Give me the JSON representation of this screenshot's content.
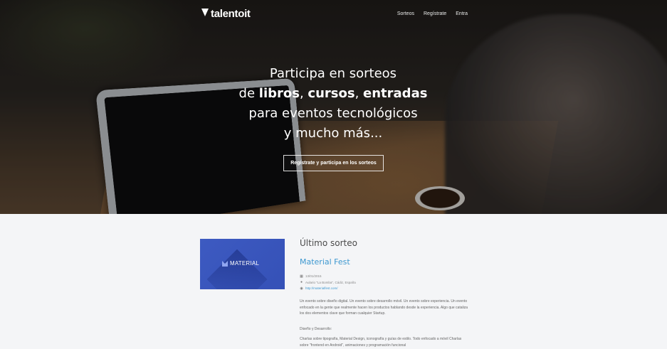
{
  "nav": {
    "logo_text": "talentoit",
    "items": [
      {
        "label": "Sorteos"
      },
      {
        "label": "Regístrate"
      },
      {
        "label": "Entra"
      }
    ]
  },
  "hero": {
    "line1": "Participa en sorteos",
    "line2_prefix": "de ",
    "line2_b1": "libros",
    "line2_sep1": ", ",
    "line2_b2": "cursos",
    "line2_sep2": ", ",
    "line2_b3": "entradas",
    "line3": "para eventos tecnológicos",
    "line4": "y mucho más...",
    "cta_label": "Regístrate y participa en los sorteos"
  },
  "latest": {
    "section_title": "Último sorteo",
    "thumb_label": "MATERIAL",
    "event_title": "Material Fest",
    "date": "13/01/2015",
    "location": "Aulario \"La Bomba\", Cádiz, España",
    "url": "http://materialfest.com/",
    "paragraph1": "Un evento sobre diseño digital. Un evento sobre desarrollo móvil. Un evento sobre experiencia. Un evento enfocado en la gente que realmente hacen los productos hablando desde la experiencia. Algo que cataliza los dos elementos clave que forman cualquier Startup.",
    "paragraph2": "Diseño y Desarrollo:",
    "paragraph3": "Charlas sobre tipografía, Material Design, iconografía y guías de estilo. Todo enfocado a móvil Charlas sobre \"frontend en Android\", animaciones y programación funcional"
  },
  "colors": {
    "accent": "#3d98d0",
    "thumb_bg": "#3d5ac1",
    "page_bg": "#f4f5f7"
  },
  "icons": [
    "calendar-icon",
    "map-marker-icon",
    "globe-icon",
    "heart-logo-icon"
  ]
}
